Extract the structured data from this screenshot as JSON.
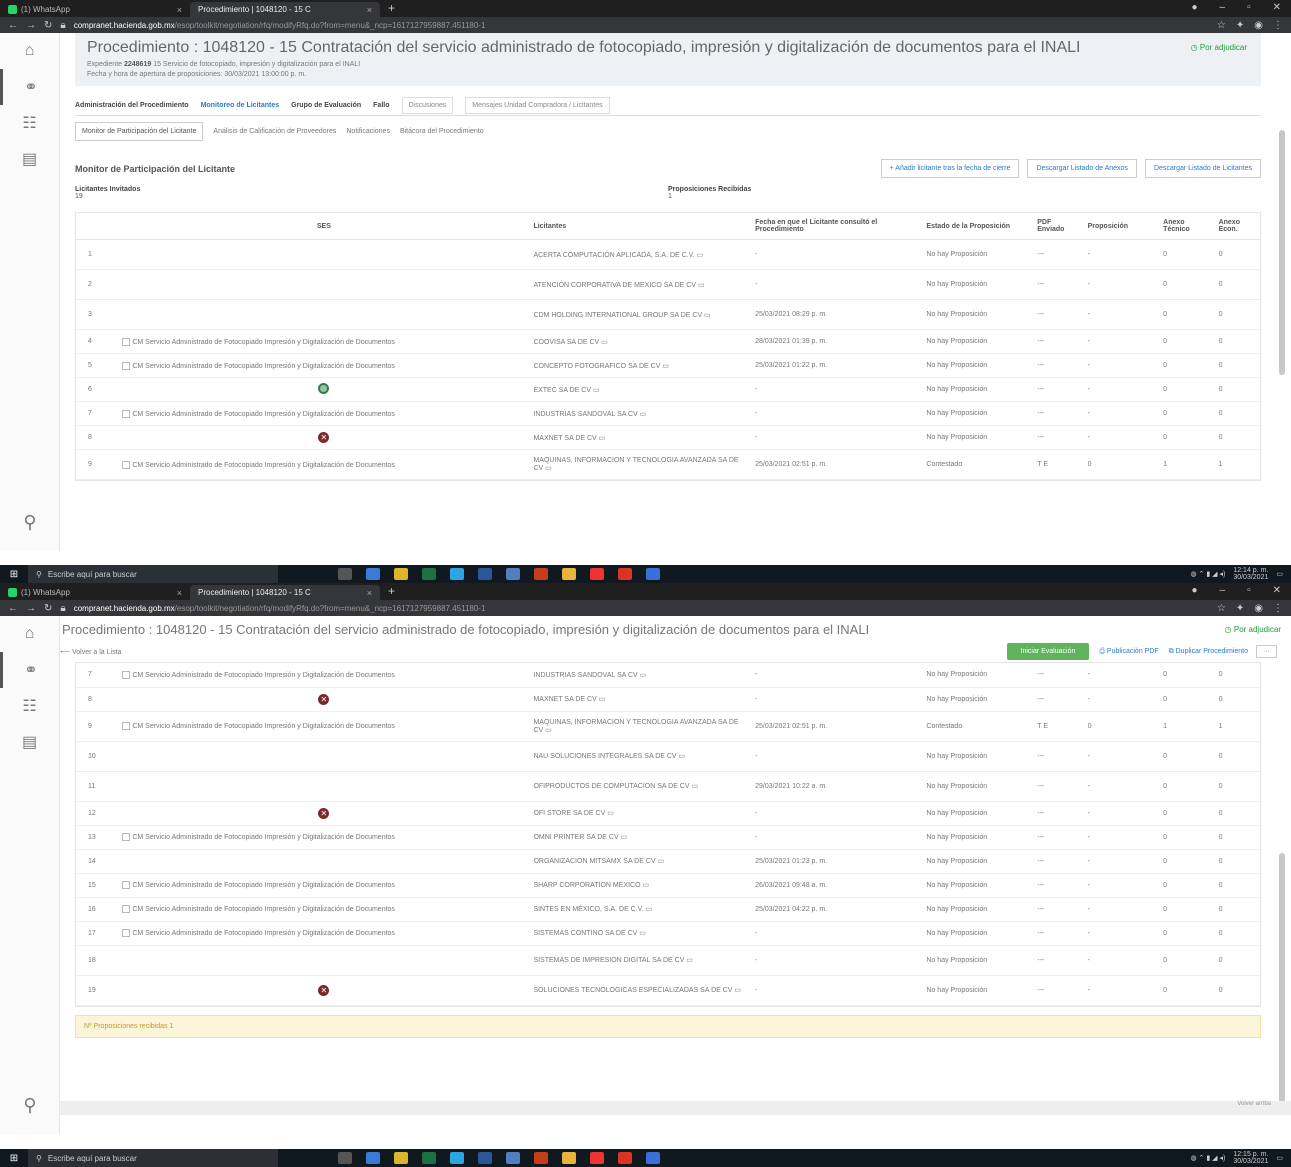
{
  "browser": {
    "tabs": [
      {
        "label": "(1) WhatsApp",
        "active": false
      },
      {
        "label": "Procedimiento | 1048120 - 15 C",
        "active": true
      }
    ],
    "url_host": "compranet.hacienda.gob.mx",
    "url_path": "/esop/toolkit/negotiation/rfq/modifyRfq.do?from=menu&_ncp=1617127959887.451180-1"
  },
  "rail": {
    "items": [
      "home-icon",
      "handshake-icon",
      "group-icon",
      "document-icon"
    ],
    "search": "search-icon"
  },
  "procedure": {
    "title": "Procedimiento : 1048120 - 15 Contratación del servicio administrado de fotocopiado, impresión y digitalización de documentos para el INALI",
    "status": "Por adjudicar",
    "expediente_label": "Expediente",
    "expediente_num": "2248619",
    "expediente_desc": "15 Servicio de fotocopiado, impresión y digitalización para el INALI",
    "fecha": "Fecha y hora de apertura de proposiciones: 30/03/2021 13:00:00 p. m."
  },
  "tabs1": [
    {
      "label": "Administración del Procedimiento",
      "active": false,
      "light": false
    },
    {
      "label": "Monitoreo de Licitantes",
      "active": true,
      "light": false
    },
    {
      "label": "Grupo de Evaluación",
      "active": false,
      "light": false
    },
    {
      "label": "Fallo",
      "active": false,
      "light": false
    },
    {
      "label": "Discusiones",
      "active": false,
      "light": true
    },
    {
      "label": "Mensajes Unidad Compradora / Licitantes",
      "active": false,
      "light": true
    }
  ],
  "tabs2": [
    {
      "label": "Monitor de Participación del Licitante",
      "active": true
    },
    {
      "label": "Análisis de Calificación de Proveedores",
      "active": false
    },
    {
      "label": "Notificaciones",
      "active": false
    },
    {
      "label": "Bitácora del Procedimiento",
      "active": false
    }
  ],
  "monitor": {
    "title": "Monitor de Participación del Licitante",
    "btn_add": "+ Añadir licitante tras la fecha de cierre",
    "btn_annex": "Descargar Listado de Anexos",
    "btn_list": "Descargar Listado de Licitantes",
    "invited_label": "Licitantes Invitados",
    "invited_value": "19",
    "received_label": "Proposiciones Recibidas",
    "received_value": "1"
  },
  "table": {
    "headers": [
      "",
      "SES",
      "Licitantes",
      "Fecha en que el Licitante consultó el Procedimiento",
      "Estado de la Proposición",
      "PDF Enviado",
      "Proposición",
      "Anexo Técnico",
      "Anexo Econ."
    ],
    "ses_text": "CM Servicio Administrado de Fotocopiado Impresión y Digitalización de Documentos",
    "rows": [
      {
        "n": "1",
        "ses": "",
        "lic": "ACERTA COMPUTACIÓN APLICADA, S.A. DE C.V. ▭",
        "fecha": "-",
        "estado": "No hay Proposición",
        "pdf": "---",
        "prop": "-",
        "at": "0",
        "ae": "0",
        "tall": true
      },
      {
        "n": "2",
        "ses": "",
        "lic": "ATENCIÓN CORPORATIVA DE MEXICO SA DE CV ▭",
        "fecha": "-",
        "estado": "No hay Proposición",
        "pdf": "---",
        "prop": "-",
        "at": "0",
        "ae": "0",
        "tall": true
      },
      {
        "n": "3",
        "ses": "",
        "lic": "CDM HOLDING INTERNATIONAL GROUP SA DE CV ▭",
        "fecha": "25/03/2021 08:29 p. m.",
        "estado": "No hay Proposición",
        "pdf": "---",
        "prop": "-",
        "at": "0",
        "ae": "0",
        "tall": true
      },
      {
        "n": "4",
        "ses": "img",
        "lic": "COOVISA SA DE CV ▭",
        "fecha": "28/03/2021 01:39 p. m.",
        "estado": "No hay Proposición",
        "pdf": "---",
        "prop": "-",
        "at": "0",
        "ae": "0",
        "tall": false
      },
      {
        "n": "5",
        "ses": "img",
        "lic": "CONCEPTO FOTOGRAFICO SA DE CV ▭",
        "fecha": "25/03/2021 01:22 p. m.",
        "estado": "No hay Proposición",
        "pdf": "---",
        "prop": "-",
        "at": "0",
        "ae": "0",
        "tall": false
      },
      {
        "n": "6",
        "ses": "ok",
        "lic": "EXTEC SA DE CV ▭",
        "fecha": "-",
        "estado": "No hay Proposición",
        "pdf": "---",
        "prop": "-",
        "at": "0",
        "ae": "0",
        "tall": false
      },
      {
        "n": "7",
        "ses": "img",
        "lic": "INDUSTRIAS SANDOVAL SA CV ▭",
        "fecha": "-",
        "estado": "No hay Proposición",
        "pdf": "---",
        "prop": "-",
        "at": "0",
        "ae": "0",
        "tall": false
      },
      {
        "n": "8",
        "ses": "no",
        "lic": "MAXNET SA DE CV ▭",
        "fecha": "-",
        "estado": "No hay Proposición",
        "pdf": "---",
        "prop": "-",
        "at": "0",
        "ae": "0",
        "tall": false
      },
      {
        "n": "9",
        "ses": "img",
        "lic": "MAQUINAS, INFORMACION Y TECNOLOGIA AVANZADA SA DE CV ▭",
        "fecha": "25/03/2021 02:51 p. m.",
        "estado": "Contestado",
        "pdf": "T E",
        "prop": "0",
        "at": "1",
        "ae": "1",
        "tall": true
      },
      {
        "n": "10",
        "ses": "",
        "lic": "NAU SOLUCIONES INTEGRALES SA DE CV ▭",
        "fecha": "-",
        "estado": "No hay Proposición",
        "pdf": "---",
        "prop": "-",
        "at": "0",
        "ae": "0",
        "tall": true
      },
      {
        "n": "11",
        "ses": "",
        "lic": "OFIPRODUCTOS DE COMPUTACION SA DE CV ▭",
        "fecha": "29/03/2021 10:22 a. m.",
        "estado": "No hay Proposición",
        "pdf": "---",
        "prop": "-",
        "at": "0",
        "ae": "0",
        "tall": true
      },
      {
        "n": "12",
        "ses": "no",
        "lic": "OFI STORE SA DE CV ▭",
        "fecha": "-",
        "estado": "No hay Proposición",
        "pdf": "---",
        "prop": "-",
        "at": "0",
        "ae": "0",
        "tall": false
      },
      {
        "n": "13",
        "ses": "img",
        "lic": "OMNI PRINTER SA DE CV ▭",
        "fecha": "-",
        "estado": "No hay Proposición",
        "pdf": "---",
        "prop": "-",
        "at": "0",
        "ae": "0",
        "tall": false
      },
      {
        "n": "14",
        "ses": "",
        "lic": "ORGANIZACION MITSAMX SA DE CV ▭",
        "fecha": "25/03/2021 01:23 p. m.",
        "estado": "No hay Proposición",
        "pdf": "---",
        "prop": "-",
        "at": "0",
        "ae": "0",
        "tall": false
      },
      {
        "n": "15",
        "ses": "img",
        "lic": "SHARP CORPORATION MEXICO ▭",
        "fecha": "26/03/2021 09:48 a. m.",
        "estado": "No hay Proposición",
        "pdf": "---",
        "prop": "-",
        "at": "0",
        "ae": "0",
        "tall": false
      },
      {
        "n": "16",
        "ses": "img",
        "lic": "SINTES EN MÉXICO, S.A. DE C.V. ▭",
        "fecha": "25/03/2021 04:22 p. m.",
        "estado": "No hay Proposición",
        "pdf": "---",
        "prop": "-",
        "at": "0",
        "ae": "0",
        "tall": false
      },
      {
        "n": "17",
        "ses": "img",
        "lic": "SISTEMAS CONTINO SA DE CV ▭",
        "fecha": "-",
        "estado": "No hay Proposición",
        "pdf": "---",
        "prop": "-",
        "at": "0",
        "ae": "0",
        "tall": false
      },
      {
        "n": "18",
        "ses": "",
        "lic": "SISTEMAS DE IMPRESION DIGITAL SA DE CV ▭",
        "fecha": "-",
        "estado": "No hay Proposición",
        "pdf": "---",
        "prop": "-",
        "at": "0",
        "ae": "0",
        "tall": true
      },
      {
        "n": "19",
        "ses": "no",
        "lic": "SOLUCIONES TECNOLOGICAS ESPECIALIZADAS SA DE CV ▭",
        "fecha": "-",
        "estado": "No hay Proposición",
        "pdf": "---",
        "prop": "-",
        "at": "0",
        "ae": "0",
        "tall": true
      }
    ]
  },
  "shot2": {
    "title": "Procedimiento : 1048120 - 15 Contratación del servicio administrado de fotocopiado, impresión y digitalización de documentos para el INALI",
    "status": "Por adjudicar",
    "back": "Volver a la Lista",
    "btn_evaluacion": "Iniciar Evaluación",
    "btn_pdf": "Publicación PDF",
    "btn_dup": "Duplicar Procedimiento",
    "more": "···",
    "footer_note": "Nº Proposiciones recibidas 1",
    "bottom_link": "Volver arriba"
  },
  "taskbar": {
    "search_placeholder": "Escribe aquí para buscar",
    "time": "12:14 p. m.",
    "date": "30/03/2021",
    "time2": "12:15 p. m."
  },
  "colors": {
    "accent": "#2a7ac9",
    "status_green": "#1f9b3a",
    "note_bg": "#fbf4d8"
  }
}
